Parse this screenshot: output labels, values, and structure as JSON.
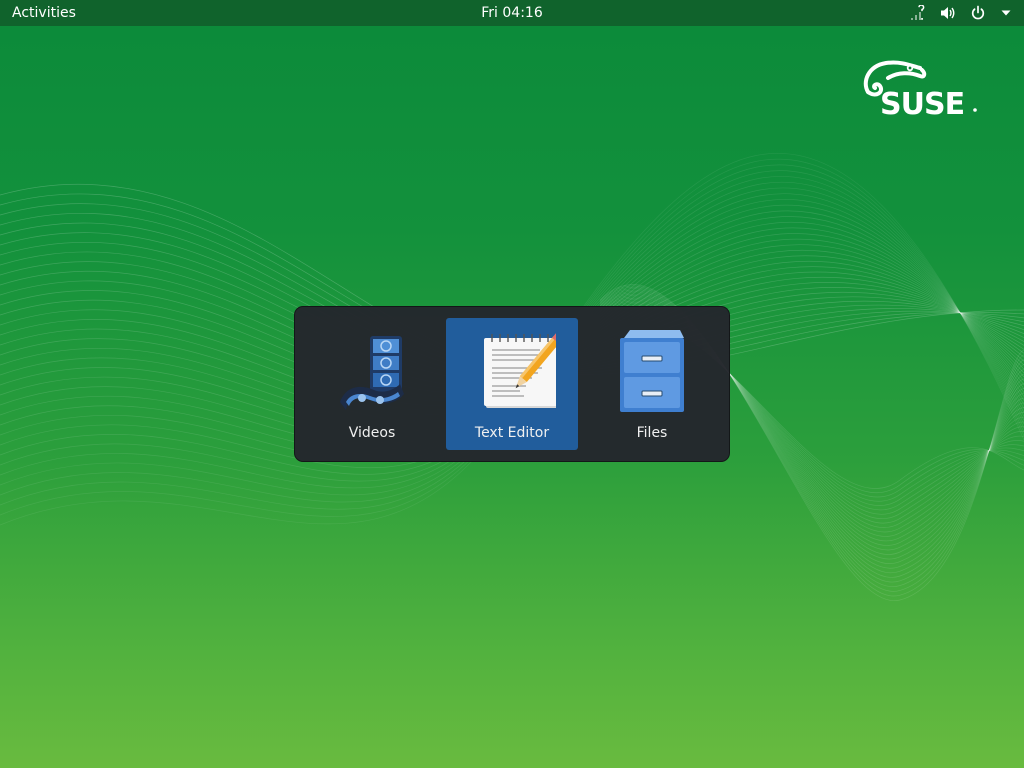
{
  "topbar": {
    "activities_label": "Activities",
    "clock": "Fri 04:16",
    "status_icons": [
      "network-unknown-icon",
      "volume-icon",
      "power-icon",
      "chevron-down-icon"
    ]
  },
  "desktop": {
    "logo_text": "SUSE"
  },
  "switcher": {
    "apps": [
      {
        "label": "Videos",
        "icon": "videos-icon",
        "selected": false
      },
      {
        "label": "Text Editor",
        "icon": "text-editor-icon",
        "selected": true
      },
      {
        "label": "Files",
        "icon": "files-icon",
        "selected": false
      }
    ]
  },
  "colors": {
    "topbar": "#10632c",
    "switcher_bg": "#24262c",
    "selection": "#215d9c"
  }
}
